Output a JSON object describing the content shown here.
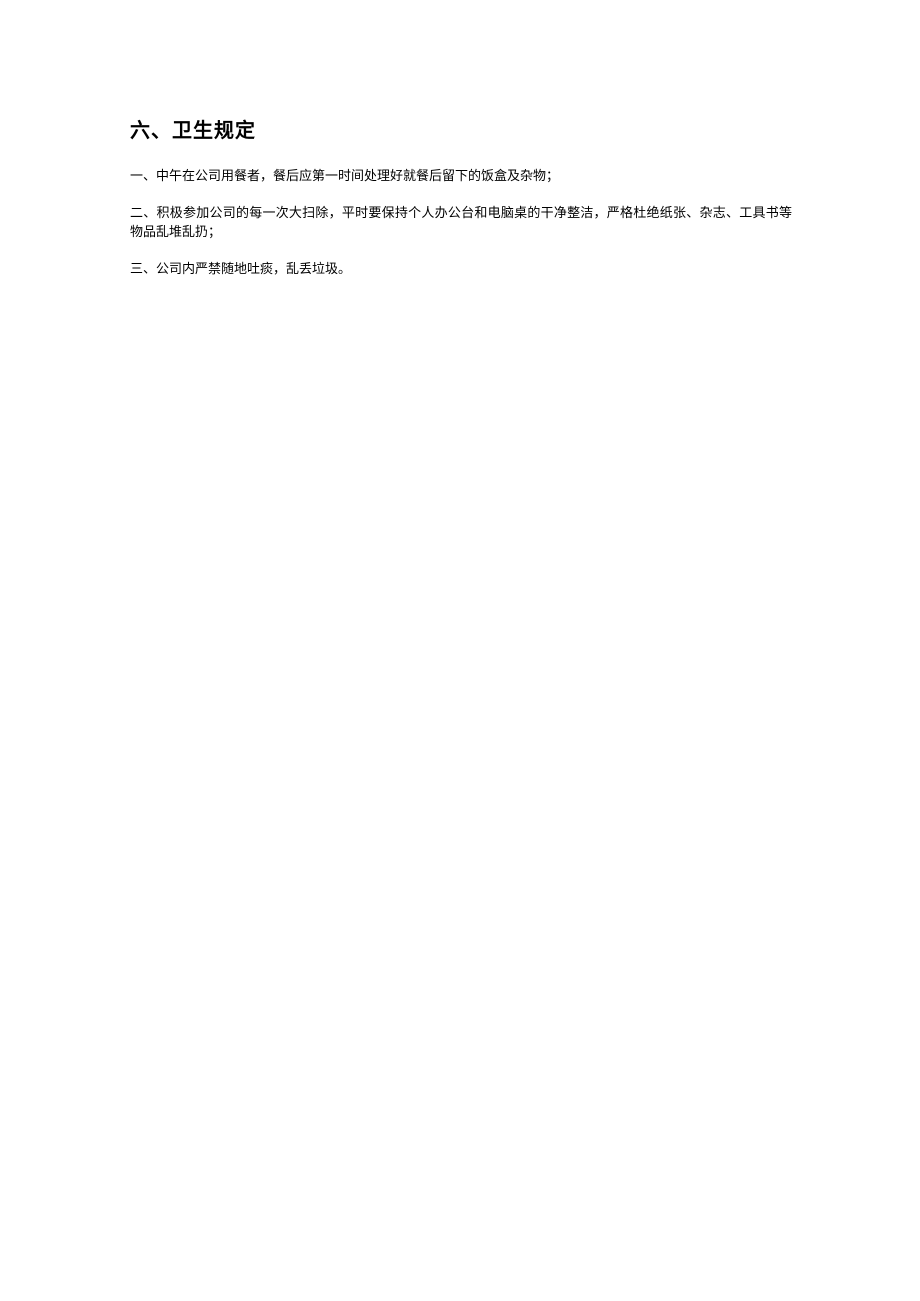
{
  "heading": "六、卫生规定",
  "paragraphs": [
    "一、中午在公司用餐者，餐后应第一时间处理好就餐后留下的饭盒及杂物；",
    "二、积极参加公司的每一次大扫除，平时要保持个人办公台和电脑桌的干净整洁，严格杜绝纸张、杂志、工具书等物品乱堆乱扔；",
    "三、公司内严禁随地吐痰，乱丢垃圾。"
  ]
}
